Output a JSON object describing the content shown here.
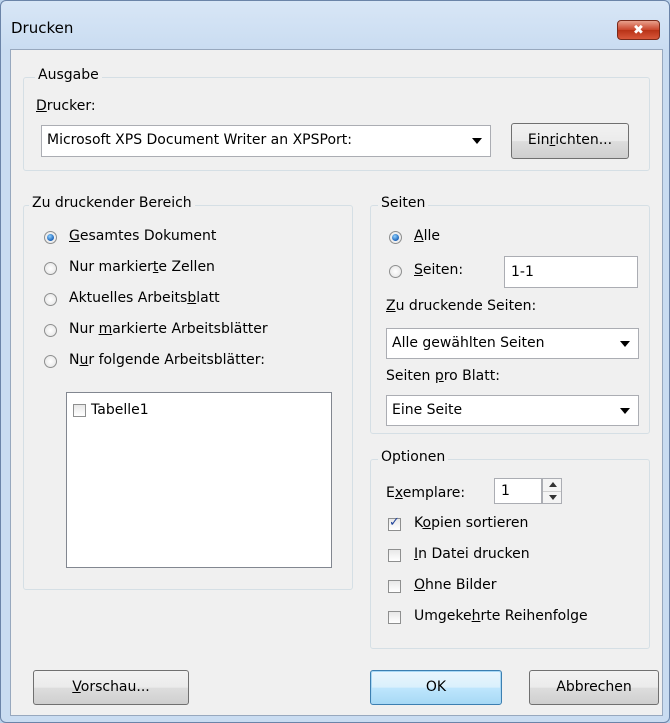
{
  "window": {
    "title": "Drucken",
    "close_icon": "close-icon",
    "close_symbol": "✖"
  },
  "output": {
    "legend": "Ausgabe",
    "printer_label_pre": "",
    "printer_label_u": "D",
    "printer_label_post": "rucker:",
    "printer_value": "Microsoft XPS Document Writer an XPSPort:",
    "setup_pre": "Ein",
    "setup_u": "r",
    "setup_post": "ichten..."
  },
  "range": {
    "legend": "Zu druckender Bereich",
    "options": [
      {
        "pre": "",
        "u": "G",
        "post": "esamtes Dokument",
        "checked": true
      },
      {
        "pre": "Nur markier",
        "u": "t",
        "post": "e Zellen",
        "checked": false
      },
      {
        "pre": "Aktuelles Arbeits",
        "u": "b",
        "post": "latt",
        "checked": false
      },
      {
        "pre": "Nur ",
        "u": "m",
        "post": "arkierte Arbeitsblätter",
        "checked": false
      },
      {
        "pre": "N",
        "u": "u",
        "post": "r folgende Arbeitsblätter:",
        "checked": false
      }
    ],
    "sheets": [
      {
        "label": "Tabelle1",
        "checked": false
      }
    ]
  },
  "pages": {
    "legend": "Seiten",
    "all": {
      "pre": "",
      "u": "A",
      "post": "lle",
      "checked": true
    },
    "pages": {
      "pre": "",
      "u": "S",
      "post": "eiten:",
      "checked": false
    },
    "pages_value": "1-1",
    "to_print_pre": "",
    "to_print_u": "Z",
    "to_print_post": "u druckende Seiten:",
    "to_print_value": "Alle gewählten Seiten",
    "per_sheet_pre": "Seiten ",
    "per_sheet_u": "p",
    "per_sheet_post": "ro Blatt:",
    "per_sheet_value": "Eine Seite"
  },
  "options": {
    "legend": "Optionen",
    "copies_pre": "E",
    "copies_u": "x",
    "copies_post": "emplare:",
    "copies_value": "1",
    "checks": [
      {
        "pre": "K",
        "u": "o",
        "post": "pien sortieren",
        "checked": true
      },
      {
        "pre": "",
        "u": "I",
        "post": "n Datei drucken",
        "checked": false
      },
      {
        "pre": "",
        "u": "O",
        "post": "hne Bilder",
        "checked": false
      },
      {
        "pre": "Umgeke",
        "u": "h",
        "post": "rte Reihenfolge",
        "checked": false
      }
    ]
  },
  "buttons": {
    "preview_pre": "",
    "preview_u": "V",
    "preview_post": "orschau...",
    "ok": "OK",
    "cancel": "Abbrechen"
  }
}
